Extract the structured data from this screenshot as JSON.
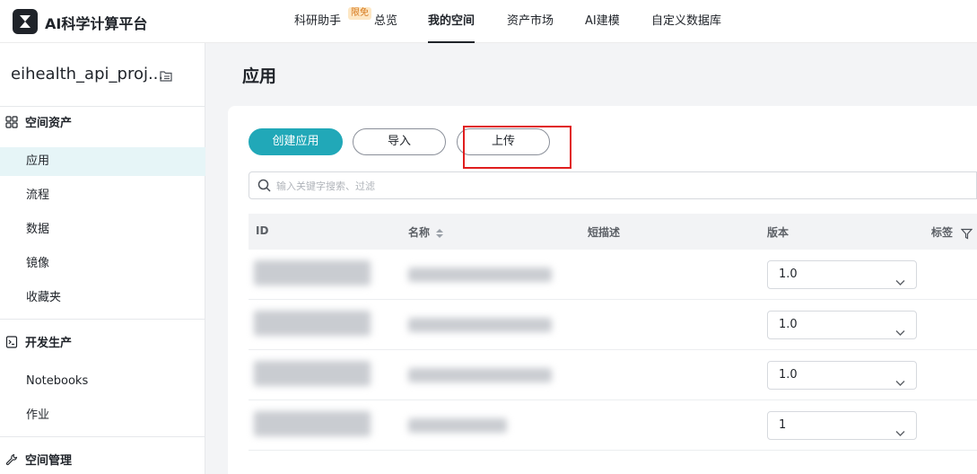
{
  "app": {
    "brand": "AI科学计算平台"
  },
  "topnav": {
    "items": [
      "科研助手",
      "总览",
      "我的空间",
      "资产市场",
      "AI建模",
      "自定义数据库"
    ],
    "badge": "限免",
    "active": "我的空间"
  },
  "sidebar": {
    "project_name": "eihealth_api_proj...",
    "groups": {
      "space_assets": "空间资产",
      "dev_production": "开发生产",
      "space_management": "空间管理"
    },
    "items": [
      "应用",
      "流程",
      "数据",
      "镜像",
      "收藏夹",
      "Notebooks",
      "作业"
    ],
    "selected": "应用"
  },
  "main": {
    "title": "应用",
    "buttons": {
      "create": "创建应用",
      "import": "导入",
      "upload": "上传"
    },
    "search": {
      "placeholder": "输入关键字搜索、过滤"
    },
    "table": {
      "columns": [
        "ID",
        "名称",
        "短描述",
        "版本",
        "标签"
      ],
      "rows": [
        {
          "version": "1.0"
        },
        {
          "version": "1.0"
        },
        {
          "version": "1.0"
        },
        {
          "version": "1"
        }
      ]
    }
  },
  "colors": {
    "accent": "#21a8b8",
    "highlight": "#e01e1e",
    "badge_text": "#d6781c"
  }
}
